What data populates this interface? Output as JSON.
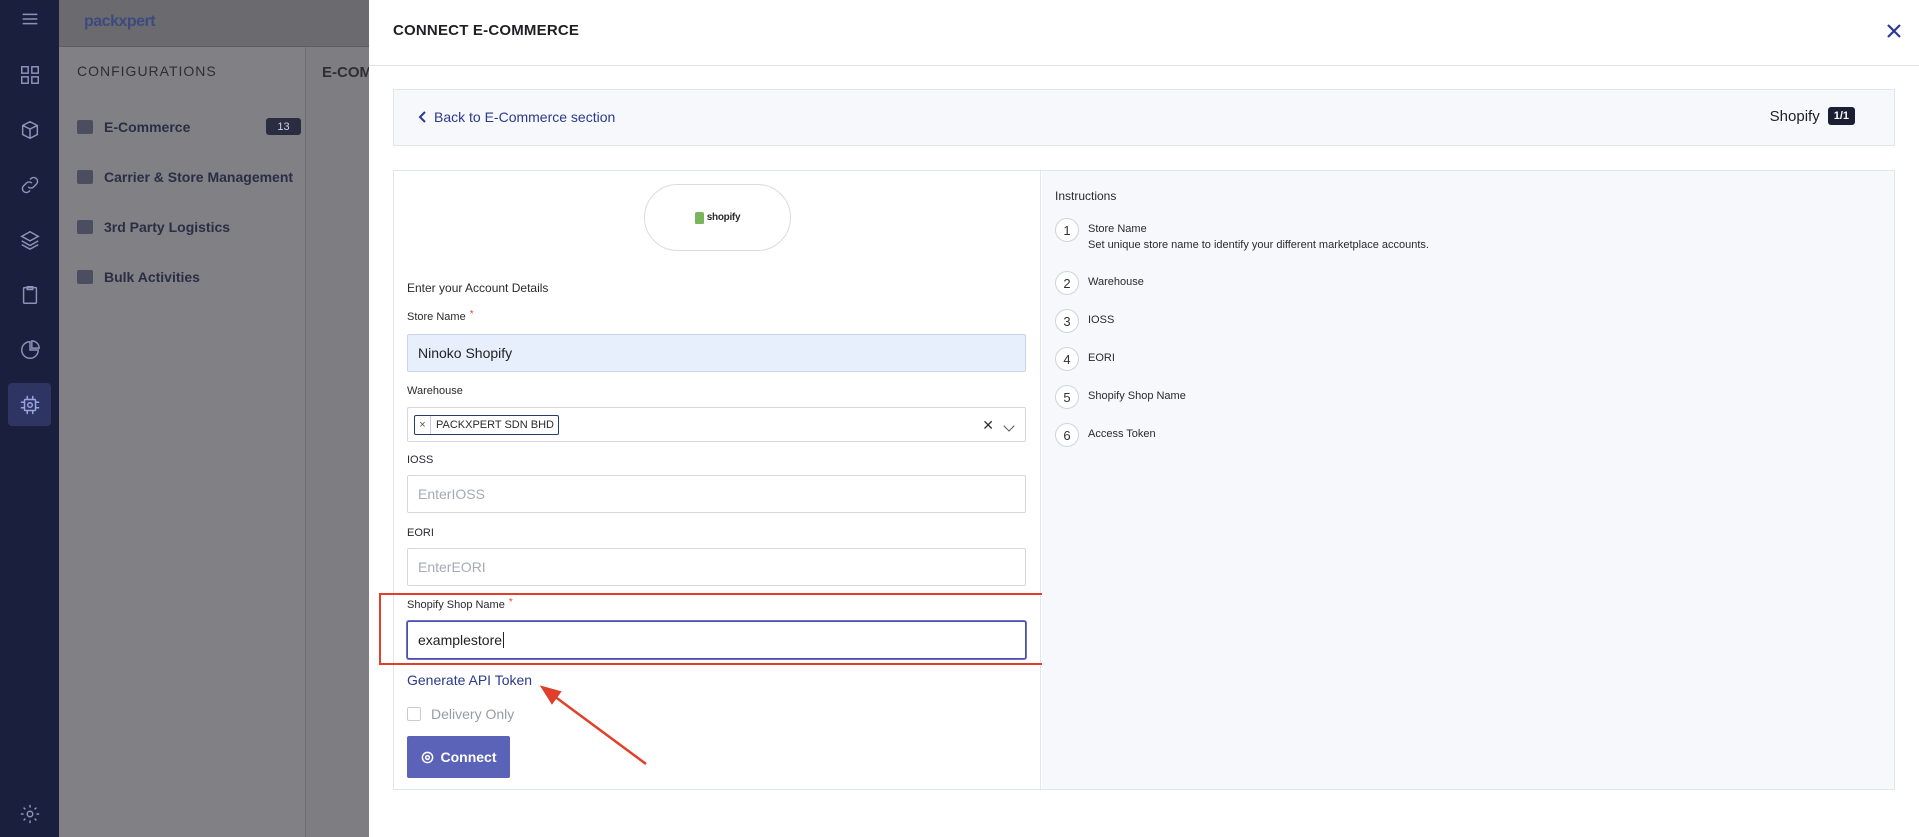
{
  "app": {
    "logo_text": "packxpert"
  },
  "rail": {
    "icons": [
      "menu-icon",
      "dashboard-icon",
      "box-icon",
      "link-icon",
      "layers-icon",
      "clipboard-icon",
      "pie-chart-icon",
      "settings-chip-icon",
      "gear-icon"
    ],
    "active": "settings-chip-icon"
  },
  "background_page": {
    "sidebar_title": "CONFIGURATIONS",
    "nav_items": [
      {
        "label": "E-Commerce",
        "badge": "13"
      },
      {
        "label": "Carrier & Store Management"
      },
      {
        "label": "3rd Party Logistics"
      },
      {
        "label": "Bulk Activities"
      }
    ],
    "heading": "E-COM"
  },
  "modal": {
    "title": "CONNECT E-COMMERCE",
    "back_link": "Back to E-Commerce section",
    "platform_name": "Shopify",
    "page_indicator": "1/1",
    "logo_text": "shopify",
    "form": {
      "section_title": "Enter your Account Details",
      "store_name": {
        "label": "Store Name",
        "value": "Ninoko Shopify"
      },
      "warehouse": {
        "label": "Warehouse",
        "selected": "PACKXPERT SDN BHD"
      },
      "ioss": {
        "label": "IOSS",
        "placeholder": "EnterIOSS"
      },
      "eori": {
        "label": "EORI",
        "placeholder": "EnterEORI"
      },
      "shop_name": {
        "label": "Shopify Shop Name",
        "value": "examplestore"
      },
      "generate_token": "Generate API Token",
      "delivery_only": "Delivery Only",
      "connect": "Connect",
      "required_mark": "*"
    },
    "instructions": {
      "title": "Instructions",
      "steps": [
        {
          "num": "1",
          "title": "Store Name",
          "desc": "Set unique store name to identify your different marketplace accounts."
        },
        {
          "num": "2",
          "title": "Warehouse"
        },
        {
          "num": "3",
          "title": "IOSS"
        },
        {
          "num": "4",
          "title": "EORI"
        },
        {
          "num": "5",
          "title": "Shopify Shop Name"
        },
        {
          "num": "6",
          "title": "Access Token"
        }
      ]
    }
  },
  "colors": {
    "rail_bg": "#1a1f3d",
    "accent": "#2b3a8c",
    "button": "#5b63b8",
    "annotation": "#e0402a",
    "shopify_green": "#7ab55c"
  }
}
